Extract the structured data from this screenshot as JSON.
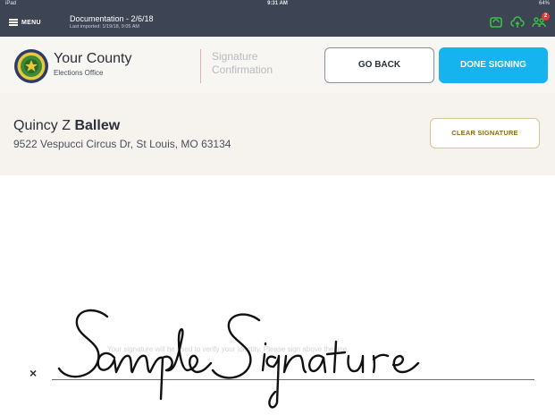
{
  "status_bar": {
    "carrier": "iPad",
    "time": "9:31 AM",
    "battery": "64%"
  },
  "nav": {
    "menu_label": "MENU",
    "title": "Documentation - 2/6/18",
    "subtitle": "Last imported: 1/19/18, 9:05 AM",
    "icons": [
      "sync-icon",
      "cloud-upload-icon",
      "people-icon"
    ],
    "notification_count": "2"
  },
  "header": {
    "county_name": "Your County",
    "office_name": "Elections Office",
    "page_label_line1": "Signature",
    "page_label_line2": "Confirmation",
    "back_label": "GO BACK",
    "done_label": "DONE SIGNING"
  },
  "voter": {
    "first_middle": "Quincy Z",
    "last": "Ballew",
    "address": "9522 Vespucci Circus Dr, St Louis, MO 63134",
    "clear_label": "CLEAR SIGNATURE"
  },
  "signature": {
    "x_mark": "×",
    "hint": "Your signature will be used to verify your identity. Please sign above the line."
  },
  "colors": {
    "navbar": "#3d4453",
    "accent": "#15b4ef",
    "icon_green": "#3fbf4a",
    "badge": "#e23b3b"
  }
}
